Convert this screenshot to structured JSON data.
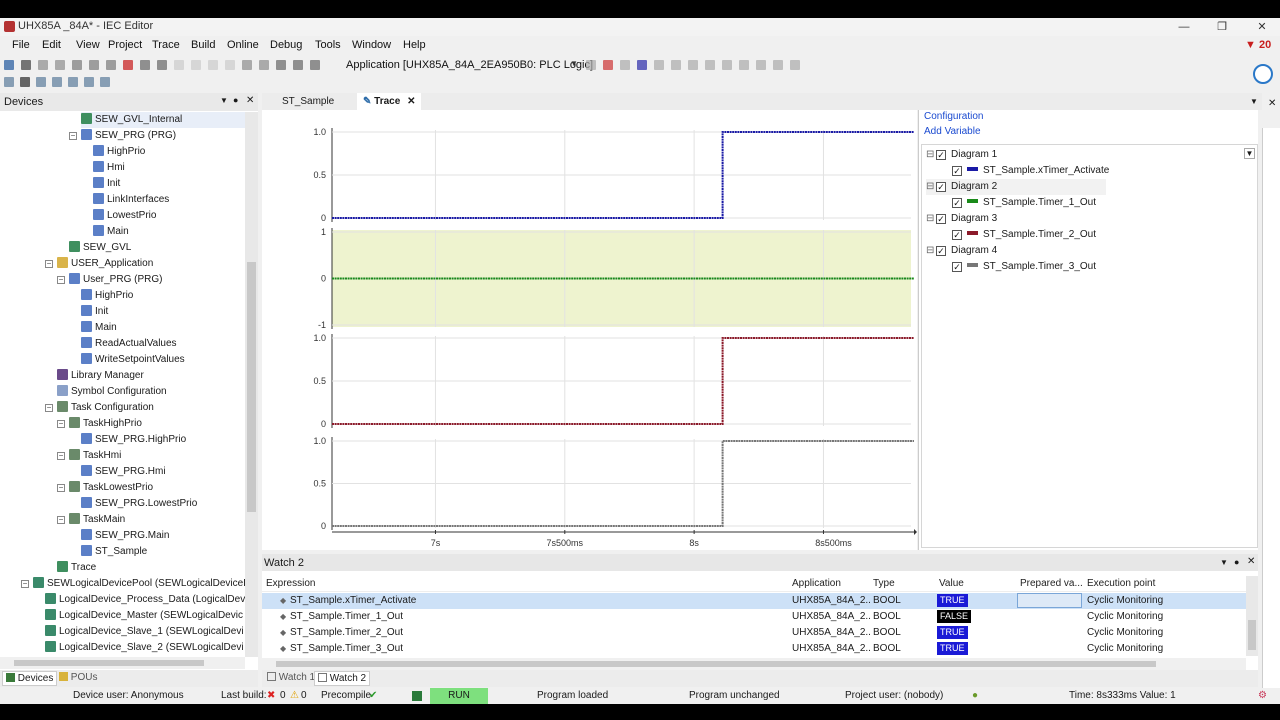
{
  "window": {
    "title": "UHX85A _84A* - IEC Editor",
    "alert_count": "20"
  },
  "menu": [
    "File",
    "Edit",
    "View",
    "Project",
    "Trace",
    "Build",
    "Online",
    "Debug",
    "Tools",
    "Window",
    "Help"
  ],
  "toolbar": {
    "application_label": "Application [UHX85A_84A_2EA950B0: PLC Logic]"
  },
  "devices": {
    "title": "Devices",
    "tree": [
      {
        "label": "SEW_GVL_Internal",
        "indent": 0,
        "selected": true
      },
      {
        "label": "SEW_PRG (PRG)",
        "indent": 0
      },
      {
        "label": "HighPrio",
        "indent": 1
      },
      {
        "label": "Hmi",
        "indent": 1
      },
      {
        "label": "Init",
        "indent": 1
      },
      {
        "label": "LinkInterfaces",
        "indent": 1
      },
      {
        "label": "LowestPrio",
        "indent": 1
      },
      {
        "label": "Main",
        "indent": 1
      },
      {
        "label": "SEW_GVL",
        "indent": -1
      },
      {
        "label": "USER_Application",
        "indent": -2
      },
      {
        "label": "User_PRG (PRG)",
        "indent": -1
      },
      {
        "label": "HighPrio",
        "indent": 0
      },
      {
        "label": "Init",
        "indent": 0
      },
      {
        "label": "Main",
        "indent": 0
      },
      {
        "label": "ReadActualValues",
        "indent": 0
      },
      {
        "label": "WriteSetpointValues",
        "indent": 0
      },
      {
        "label": "Library Manager",
        "indent": -2
      },
      {
        "label": "Symbol Configuration",
        "indent": -2
      },
      {
        "label": "Task Configuration",
        "indent": -2
      },
      {
        "label": "TaskHighPrio",
        "indent": -1
      },
      {
        "label": "SEW_PRG.HighPrio",
        "indent": 0
      },
      {
        "label": "TaskHmi",
        "indent": -1
      },
      {
        "label": "SEW_PRG.Hmi",
        "indent": 0
      },
      {
        "label": "TaskLowestPrio",
        "indent": -1
      },
      {
        "label": "SEW_PRG.LowestPrio",
        "indent": 0
      },
      {
        "label": "TaskMain",
        "indent": -1
      },
      {
        "label": "SEW_PRG.Main",
        "indent": 0
      },
      {
        "label": "ST_Sample",
        "indent": 0
      },
      {
        "label": "Trace",
        "indent": -2
      },
      {
        "label": "SEWLogicalDevicePool (SEWLogicalDeviceF",
        "indent": -4
      },
      {
        "label": "LogicalDevice_Process_Data (LogicalDev",
        "indent": -3
      },
      {
        "label": "LogicalDevice_Master (SEWLogicalDevic",
        "indent": -3
      },
      {
        "label": "LogicalDevice_Slave_1 (SEWLogicalDevi",
        "indent": -3
      },
      {
        "label": "LogicalDevice_Slave_2 (SEWLogicalDevi",
        "indent": -3
      }
    ],
    "bottom_tabs": [
      "Devices",
      "POUs"
    ]
  },
  "editor_tabs": [
    "ST_Sample",
    "Trace"
  ],
  "trace": {
    "config_link": "Configuration",
    "add_variable_link": "Add Variable",
    "legend": [
      {
        "diagram": "Diagram 1",
        "variable": "ST_Sample.xTimer_Activate",
        "color": "#1a1aa6"
      },
      {
        "diagram": "Diagram 2",
        "variable": "ST_Sample.Timer_1_Out",
        "color": "#1a8a1a"
      },
      {
        "diagram": "Diagram 3",
        "variable": "ST_Sample.Timer_2_Out",
        "color": "#8c1a2a"
      },
      {
        "diagram": "Diagram 4",
        "variable": "ST_Sample.Timer_3_Out",
        "color": "#777777"
      }
    ],
    "x_ticks": [
      "7s",
      "7s500ms",
      "8s",
      "8s500ms"
    ]
  },
  "chart_data": {
    "type": "line",
    "x": {
      "ticks": [
        "7s",
        "7s500ms",
        "8s",
        "8s500ms"
      ],
      "range_s": [
        6.6,
        8.85
      ]
    },
    "series": [
      {
        "name": "ST_Sample.xTimer_Activate",
        "diagram": "Diagram 1",
        "y_ticks": [
          "1.0",
          "0.5",
          "0"
        ],
        "ylim": [
          0,
          1
        ],
        "color": "#1a1aa6",
        "points": [
          [
            6.6,
            0
          ],
          [
            8.11,
            0
          ],
          [
            8.11,
            1
          ],
          [
            8.85,
            1
          ]
        ]
      },
      {
        "name": "ST_Sample.Timer_1_Out",
        "diagram": "Diagram 2",
        "y_ticks": [
          "1",
          "0",
          "-1"
        ],
        "ylim": [
          -1,
          1
        ],
        "color": "#1a8a1a",
        "points": [
          [
            6.6,
            0
          ],
          [
            8.85,
            0
          ]
        ],
        "highlight": true
      },
      {
        "name": "ST_Sample.Timer_2_Out",
        "diagram": "Diagram 3",
        "y_ticks": [
          "1.0",
          "0.5",
          "0"
        ],
        "ylim": [
          0,
          1
        ],
        "color": "#8c1a2a",
        "points": [
          [
            6.6,
            0
          ],
          [
            8.11,
            0
          ],
          [
            8.11,
            1
          ],
          [
            8.85,
            1
          ]
        ]
      },
      {
        "name": "ST_Sample.Timer_3_Out",
        "diagram": "Diagram 4",
        "y_ticks": [
          "1.0",
          "0.5",
          "0"
        ],
        "ylim": [
          0,
          1
        ],
        "color": "#777777",
        "points": [
          [
            6.6,
            0
          ],
          [
            8.11,
            0
          ],
          [
            8.11,
            1
          ],
          [
            8.85,
            1
          ]
        ]
      }
    ]
  },
  "watch": {
    "title": "Watch 2",
    "columns": [
      "Expression",
      "Application",
      "Type",
      "Value",
      "Prepared va...",
      "Execution point"
    ],
    "rows": [
      {
        "expression": "ST_Sample.xTimer_Activate",
        "application": "UHX85A_84A_2...",
        "type": "BOOL",
        "value": "TRUE",
        "prepared": "",
        "exec": "Cyclic Monitoring",
        "selected": true
      },
      {
        "expression": "ST_Sample.Timer_1_Out",
        "application": "UHX85A_84A_2...",
        "type": "BOOL",
        "value": "FALSE",
        "prepared": "",
        "exec": "Cyclic Monitoring"
      },
      {
        "expression": "ST_Sample.Timer_2_Out",
        "application": "UHX85A_84A_2...",
        "type": "BOOL",
        "value": "TRUE",
        "prepared": "",
        "exec": "Cyclic Monitoring"
      },
      {
        "expression": "ST_Sample.Timer_3_Out",
        "application": "UHX85A_84A_2...",
        "type": "BOOL",
        "value": "TRUE",
        "prepared": "",
        "exec": "Cyclic Monitoring"
      }
    ],
    "bottom_tabs": [
      "Watch 1",
      "Watch 2"
    ]
  },
  "status": {
    "device_user": "Device user: Anonymous",
    "last_build": "Last build:",
    "errors": "0",
    "warnings": "0",
    "precompile": "Precompile",
    "run": "RUN",
    "program_loaded": "Program loaded",
    "program_unchanged": "Program unchanged",
    "project_user": "Project user: (nobody)",
    "time": "Time: 8s333ms  Value: 1"
  },
  "colors": {
    "accent": "#1a1aa6",
    "run_green": "#7ee07e",
    "true_badge": "#1a1ad6",
    "false_badge": "#000000",
    "plot_highlight": "#eef3cf"
  }
}
